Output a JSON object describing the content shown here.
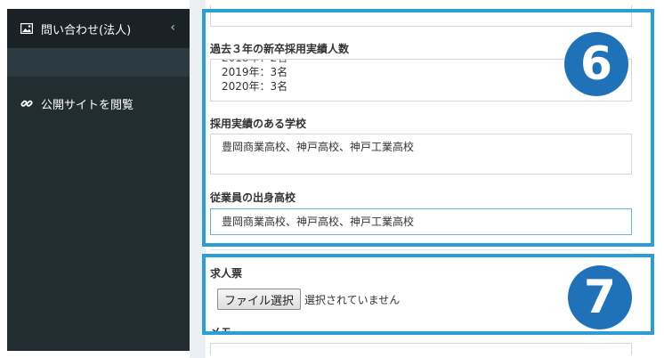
{
  "sidebar": {
    "items": [
      {
        "label": "問い合わせ(法人)",
        "icon": "image-icon",
        "has_chevron": true
      },
      {
        "label": "公開サイトを閲覧",
        "icon": "link-icon"
      }
    ],
    "chevron": "‹"
  },
  "form": {
    "past_hires": {
      "label": "過去３年の新卒採用実績人数",
      "lines": [
        "2019年：3名",
        "2020年：3名"
      ]
    },
    "schools": {
      "label": "採用実績のある学校",
      "value": "豊岡商業高校、神戸高校、神戸工業高校"
    },
    "employee_schools": {
      "label": "従業員の出身高校",
      "value": "豊岡商業高校、神戸高校、神戸工業高校"
    },
    "job_posting": {
      "label": "求人票",
      "file_button": "ファイル選択",
      "file_status": "選択されていません"
    },
    "memo": {
      "label": "メモ"
    }
  },
  "badges": {
    "six": "6",
    "seven": "7"
  },
  "colors": {
    "sidebar_bg": "#222d32",
    "frame": "#2b9ed8",
    "badge": "#1f72b8"
  }
}
